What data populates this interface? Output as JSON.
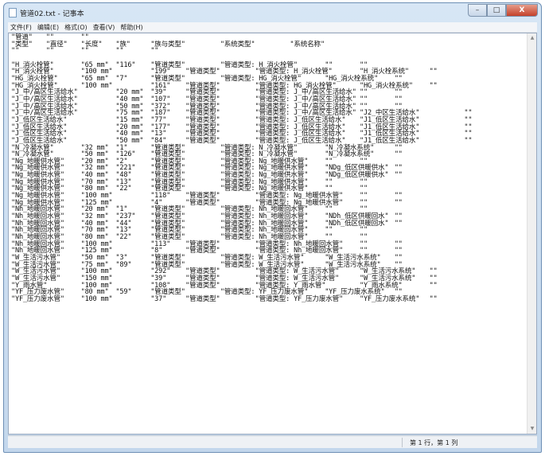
{
  "window": {
    "title": "管道02.txt - 记事本",
    "minimize": "–",
    "maximize": "□",
    "close": "X"
  },
  "menu": [
    "文件(F)",
    "编辑(E)",
    "格式(O)",
    "查看(V)",
    "帮助(H)"
  ],
  "lines": [
    [
      "\"管道\"",
      "\"\"",
      "\"\""
    ],
    [
      "\"类型\"",
      "\"直径\"",
      "\"长度\"",
      "\"族\"",
      "\"族与类型\"",
      "\"系统类型\"",
      "\"系统名称\""
    ],
    [
      "\"\"",
      "\"\"",
      "\"\"",
      "\"\"",
      "\"\""
    ],
    [
      ""
    ],
    [
      "\"H_消火栓管\"",
      "\"65 mm\"",
      "\"116\"",
      "\"管道类型\"",
      "\"管道类型: H_消火栓管\"",
      "\"\"",
      "\"\""
    ],
    [
      "\"H_消火栓管\"",
      "\"100 mm\"",
      "",
      "\"199\"",
      "\"管道类型\"",
      "\"管道类型: H_消火栓管\"",
      "\"H_消火栓系统\"",
      "\"\""
    ],
    [
      "\"HG_消火栓管\"",
      "\"65 mm\"",
      "\"7\"",
      "\"管道类型\"",
      "\"管道类型: HG_消火栓管\"",
      "\"HG_消火栓系统\"",
      "\"\""
    ],
    [
      "\"HG_消火栓管\"",
      "\"100 mm\"",
      "",
      "\"161\"",
      "\"管道类型\"",
      "\"管道类型: HG_消火栓管\"",
      "\"HG_消火栓系统\"",
      "\"\""
    ],
    [
      "\"J_中/高区生活给水\"",
      "",
      "\"20 mm\"",
      "\"39\"",
      "\"管道类型\"",
      "\"管道类型: J_中/高区生活给水\"",
      "\"\"",
      "\"\""
    ],
    [
      "\"J_中/高区生活给水\"",
      "",
      "\"40 mm\"",
      "\"107\"",
      "\"管道类型\"",
      "\"管道类型: J_中/高区生活给水\"",
      "\"\"",
      "\"\""
    ],
    [
      "\"J_中/高区生活给水\"",
      "",
      "\"50 mm\"",
      "\"372\"",
      "\"管道类型\"",
      "\"管道类型: J_中/高区生活给水\"",
      "\"\"",
      "\"\""
    ],
    [
      "\"J_中/高区生活给水\"",
      "",
      "\"75 mm\"",
      "\"187\"",
      "\"管道类型\"",
      "\"管道类型: J_中/高区生活给水\"",
      "\"J2_中区生活给水\"",
      "",
      "\"\""
    ],
    [
      "\"J_低区生活给水\"",
      "",
      "\"15 mm\"",
      "\"77\"",
      "\"管道类型\"",
      "\"管道类型: J_低区生活给水\"",
      "\"J1_低区生活给水\"",
      "",
      "\"\""
    ],
    [
      "\"J_低区生活给水\"",
      "",
      "\"20 mm\"",
      "\"177\"",
      "\"管道类型\"",
      "\"管道类型: J_低区生活给水\"",
      "\"J1_低区生活给水\"",
      "",
      "\"\""
    ],
    [
      "\"J_低区生活给水\"",
      "",
      "\"40 mm\"",
      "\"13\"",
      "\"管道类型\"",
      "\"管道类型: J_低区生活给水\"",
      "\"J1_低区生活给水\"",
      "",
      "\"\""
    ],
    [
      "\"J_低区生活给水\"",
      "",
      "\"50 mm\"",
      "\"84\"",
      "\"管道类型\"",
      "\"管道类型: J_低区生活给水\"",
      "\"J1_低区生活给水\"",
      "",
      "\"\""
    ],
    [
      "\"N_冷凝水管\"",
      "\"32 mm\"",
      "\"1\"",
      "\"管道类型\"",
      "\"管道类型: N_冷凝水管\"",
      "\"N_冷凝水系统\"",
      "\"\""
    ],
    [
      "\"N_冷凝水管\"",
      "\"50 mm\"",
      "\"126\"",
      "\"管道类型\"",
      "\"管道类型: N_冷凝水管\"",
      "\"N_冷凝水系统\"",
      "\"\""
    ],
    [
      "\"Ng_地暖供水管\"",
      "\"20 mm\"",
      "\"2\"",
      "\"管道类型\"",
      "\"管道类型: Ng_地暖供水管\"",
      "\"\"",
      "\"\""
    ],
    [
      "\"Ng_地暖供水管\"",
      "\"32 mm\"",
      "\"221\"",
      "\"管道类型\"",
      "\"管道类型: Ng_地暖供水管\"",
      "\"NDg_低区供暖供水\"",
      "\"\""
    ],
    [
      "\"Ng_地暖供水管\"",
      "\"40 mm\"",
      "\"48\"",
      "\"管道类型\"",
      "\"管道类型: Ng_地暖供水管\"",
      "\"NDg_低区供暖供水\"",
      "\"\""
    ],
    [
      "\"Ng_地暖供水管\"",
      "\"70 mm\"",
      "\"13\"",
      "\"管道类型\"",
      "\"管道类型: Ng_地暖供水管\"",
      "\"\"",
      "\"\""
    ],
    [
      "\"Ng_地暖供水管\"",
      "\"80 mm\"",
      "\"22\"",
      "\"管道类型\"",
      "\"管道类型: Ng_地暖供水管\"",
      "\"\"",
      "\"\""
    ],
    [
      "\"Ng_地暖供水管\"",
      "\"100 mm\"",
      "",
      "\"118\"",
      "\"管道类型\"",
      "\"管道类型: Ng_地暖供水管\"",
      "\"\"",
      "\"\""
    ],
    [
      "\"Ng_地暖供水管\"",
      "\"125 mm\"",
      "",
      "\"4\"",
      "\"管道类型\"",
      "\"管道类型: Ng_地暖供水管\"",
      "\"\"",
      "\"\""
    ],
    [
      "\"Nh_地暖回水管\"",
      "\"20 mm\"",
      "\"1\"",
      "\"管道类型\"",
      "\"管道类型: Nh_地暖回水管\"",
      "\"\"",
      "\"\""
    ],
    [
      "\"Nh_地暖回水管\"",
      "\"32 mm\"",
      "\"237\"",
      "\"管道类型\"",
      "\"管道类型: Nh_地暖回水管\"",
      "\"NDh_低区供暖回水\"",
      "\"\""
    ],
    [
      "\"Nh_地暖回水管\"",
      "\"40 mm\"",
      "\"44\"",
      "\"管道类型\"",
      "\"管道类型: Nh_地暖回水管\"",
      "\"NDh_低区供暖回水\"",
      "\"\""
    ],
    [
      "\"Nh_地暖回水管\"",
      "\"70 mm\"",
      "\"13\"",
      "\"管道类型\"",
      "\"管道类型: Nh_地暖回水管\"",
      "\"\"",
      "\"\""
    ],
    [
      "\"Nh_地暖回水管\"",
      "\"80 mm\"",
      "\"22\"",
      "\"管道类型\"",
      "\"管道类型: Nh_地暖回水管\"",
      "\"\"",
      "\"\""
    ],
    [
      "\"Nh_地暖回水管\"",
      "\"100 mm\"",
      "",
      "\"113\"",
      "\"管道类型\"",
      "\"管道类型: Nh_地暖回水管\"",
      "\"\"",
      "\"\""
    ],
    [
      "\"Nh_地暖回水管\"",
      "\"125 mm\"",
      "",
      "\"8\"",
      "\"管道类型\"",
      "\"管道类型: Nh_地暖回水管\"",
      "\"\"",
      "\"\""
    ],
    [
      "\"W_生活污水管\"",
      "\"50 mm\"",
      "\"3\"",
      "\"管道类型\"",
      "\"管道类型: W_生活污水管\"",
      "\"W_生活污水系统\"",
      "\"\""
    ],
    [
      "\"W_生活污水管\"",
      "\"75 mm\"",
      "\"89\"",
      "\"管道类型\"",
      "\"管道类型: W_生活污水管\"",
      "\"W_生活污水系统\"",
      "\"\""
    ],
    [
      "\"W_生活污水管\"",
      "\"100 mm\"",
      "",
      "\"292\"",
      "\"管道类型\"",
      "\"管道类型: W_生活污水管\"",
      "\"W_生活污水系统\"",
      "\"\""
    ],
    [
      "\"W_生活污水管\"",
      "\"150 mm\"",
      "",
      "\"39\"",
      "\"管道类型\"",
      "\"管道类型: W_生活污水管\"",
      "\"W_生活污水系统\"",
      "\"\""
    ],
    [
      "\"Y_雨水管\"",
      "\"100 mm\"",
      "",
      "\"108\"",
      "\"管道类型\"",
      "\"管道类型: Y_雨水管\"",
      "\"Y_雨水系统\"",
      "\"\""
    ],
    [
      "\"YF_压力废水管\"",
      "\"80 mm\"",
      "\"59\"",
      "\"管道类型\"",
      "\"管道类型: YF_压力废水管\"",
      "\"YF_压力废水系统\"",
      "\"\""
    ],
    [
      "\"YF_压力废水管\"",
      "\"100 mm\"",
      "",
      "\"37\"",
      "\"管道类型\"",
      "\"管道类型: YF_压力废水管\"",
      "\"YF_压力废水系统\"",
      "\"\""
    ]
  ],
  "status": {
    "position": "第 1 行，第 1 列"
  },
  "scrollbar": {
    "up": "▲",
    "down": "▼"
  }
}
